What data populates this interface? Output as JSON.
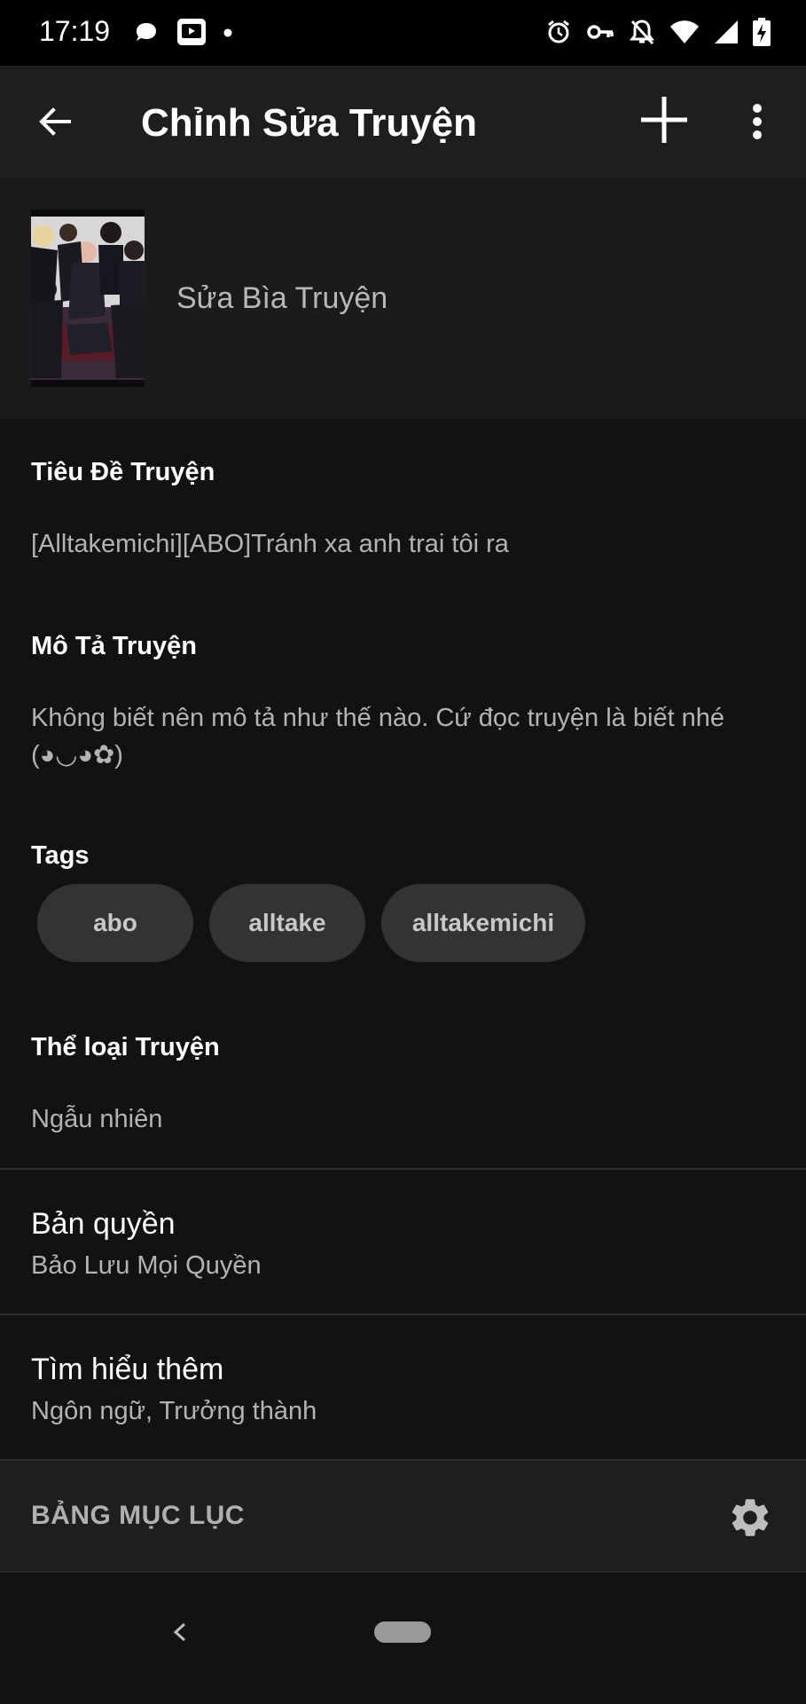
{
  "status_bar": {
    "time": "17:19"
  },
  "app_bar": {
    "title": "Chỉnh Sửa Truyện"
  },
  "cover": {
    "label": "Sửa Bìa Truyện"
  },
  "title_field": {
    "label": "Tiêu Đề Truyện",
    "value": "[Alltakemichi][ABO]Tránh xa anh trai tôi ra"
  },
  "description_field": {
    "label": "Mô Tả Truyện",
    "line1": "Không biết nên mô tả như thế nào. Cứ đọc truyện là biết nhé",
    "line2": "(◕◡◕✿)"
  },
  "tags": {
    "label": "Tags",
    "items": [
      "abo",
      "alltake",
      "alltakemichi"
    ]
  },
  "category_field": {
    "label": "Thể loại Truyện",
    "value": "Ngẫu nhiên"
  },
  "copyright_row": {
    "title": "Bản quyền",
    "subtitle": "Bảo Lưu Mọi Quyền"
  },
  "more_row": {
    "title": "Tìm hiểu thêm",
    "subtitle": "Ngôn ngữ, Trưởng thành"
  },
  "toc": {
    "title": "BẢNG MỤC LỤC"
  },
  "icons": {
    "status": [
      "chat-bubble-icon",
      "video-app-icon",
      "dot-icon",
      "alarm-icon",
      "vpn-key-icon",
      "notifications-off-icon",
      "wifi-icon",
      "signal-icon",
      "battery-charging-icon"
    ],
    "app_bar": [
      "back-arrow-icon",
      "plus-icon",
      "more-vertical-icon"
    ],
    "toc": "gear-icon",
    "nav": [
      "nav-back-icon",
      "home-pill-icon"
    ]
  },
  "colors": {
    "background": "#121212",
    "app_bar": "#1e1e1e",
    "chip": "#333333",
    "secondary_text": "#b3b3b3"
  }
}
